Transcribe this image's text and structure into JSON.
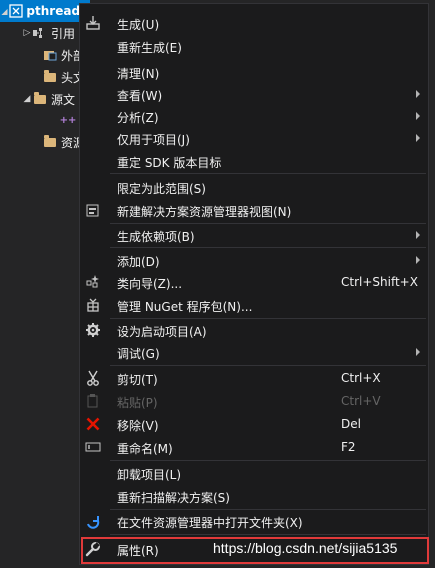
{
  "tree": {
    "items": [
      {
        "label": "pthreadD",
        "selected": true
      },
      {
        "label": "引用"
      },
      {
        "label": "外部"
      },
      {
        "label": "头文"
      },
      {
        "label": "源文"
      },
      {
        "label": ""
      },
      {
        "label": "资源"
      }
    ]
  },
  "menu": {
    "items": [
      {
        "label": "生成(U)",
        "icon": "build-icon"
      },
      {
        "label": "重新生成(E)"
      },
      {
        "label": "清理(N)"
      },
      {
        "label": "查看(W)",
        "submenu": true
      },
      {
        "label": "分析(Z)",
        "submenu": true
      },
      {
        "label": "仅用于项目(J)",
        "submenu": true
      },
      {
        "label": "重定 SDK 版本目标"
      },
      {
        "label": "限定为此范围(S)"
      },
      {
        "label": "新建解决方案资源管理器视图(N)",
        "icon": "new-view-icon"
      },
      {
        "label": "生成依赖项(B)",
        "submenu": true
      },
      {
        "label": "添加(D)",
        "submenu": true
      },
      {
        "label": "类向导(Z)...",
        "shortcut": "Ctrl+Shift+X",
        "icon": "class-wizard-icon"
      },
      {
        "label": "管理 NuGet 程序包(N)...",
        "icon": "nuget-icon"
      },
      {
        "label": "设为启动项目(A)",
        "icon": "gear-icon"
      },
      {
        "label": "调试(G)",
        "submenu": true
      },
      {
        "label": "剪切(T)",
        "shortcut": "Ctrl+X",
        "icon": "scissors-icon"
      },
      {
        "label": "粘贴(P)",
        "shortcut": "Ctrl+V",
        "icon": "paste-icon",
        "disabled": true
      },
      {
        "label": "移除(V)",
        "shortcut": "Del",
        "icon": "remove-icon"
      },
      {
        "label": "重命名(M)",
        "shortcut": "F2",
        "icon": "rename-icon"
      },
      {
        "label": "卸载项目(L)"
      },
      {
        "label": "重新扫描解决方案(S)"
      },
      {
        "label": "在文件资源管理器中打开文件夹(X)",
        "icon": "refresh-icon"
      },
      {
        "label": "属性(R)",
        "icon": "wrench-icon"
      }
    ]
  },
  "watermark": "https://blog.csdn.net/sijia5135",
  "colors": {
    "accent": "#007acc",
    "highlight_border": "#e03a3a",
    "remove": "#e51400"
  }
}
